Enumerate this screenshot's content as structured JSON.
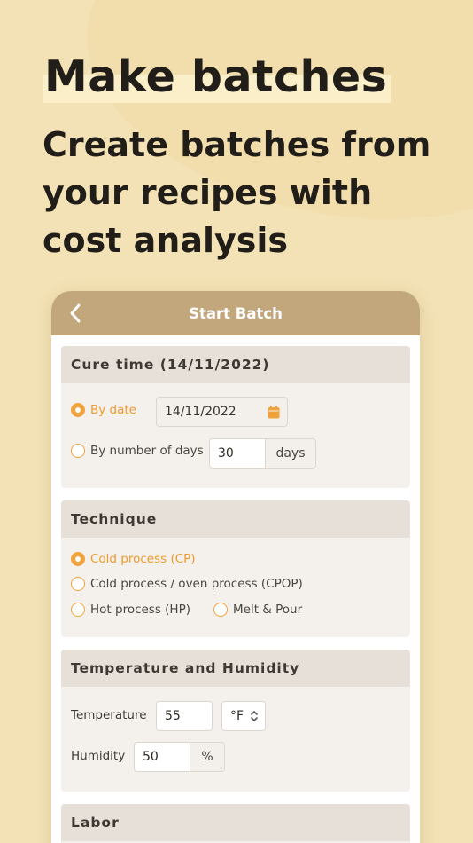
{
  "hero": {
    "title": "Make batches",
    "subtitle": "Create batches from your recipes with cost analysis"
  },
  "nav": {
    "title": "Start Batch"
  },
  "cure": {
    "header": "Cure time (14/11/2022)",
    "by_date_label": "By date",
    "date_value": "14/11/2022",
    "by_days_label": "By number of days",
    "days_value": "30",
    "days_unit": "days"
  },
  "technique": {
    "header": "Technique",
    "options": [
      "Cold process (CP)",
      "Cold process / oven process (CPOP)",
      "Hot process (HP)",
      "Melt & Pour"
    ],
    "selected": "Cold process (CP)"
  },
  "temp": {
    "header": "Temperature and Humidity",
    "temperature_label": "Temperature",
    "temperature_value": "55",
    "temperature_unit": "°F",
    "humidity_label": "Humidity",
    "humidity_value": "50",
    "humidity_unit": "%"
  },
  "labor": {
    "header": "Labor"
  },
  "colors": {
    "accent": "#f0a33c",
    "navbar": "#c2a67c",
    "background": "#f3e2b5"
  },
  "icons": {
    "back": "chevron-left-icon",
    "calendar": "calendar-icon",
    "select": "chevron-up-down-icon"
  }
}
